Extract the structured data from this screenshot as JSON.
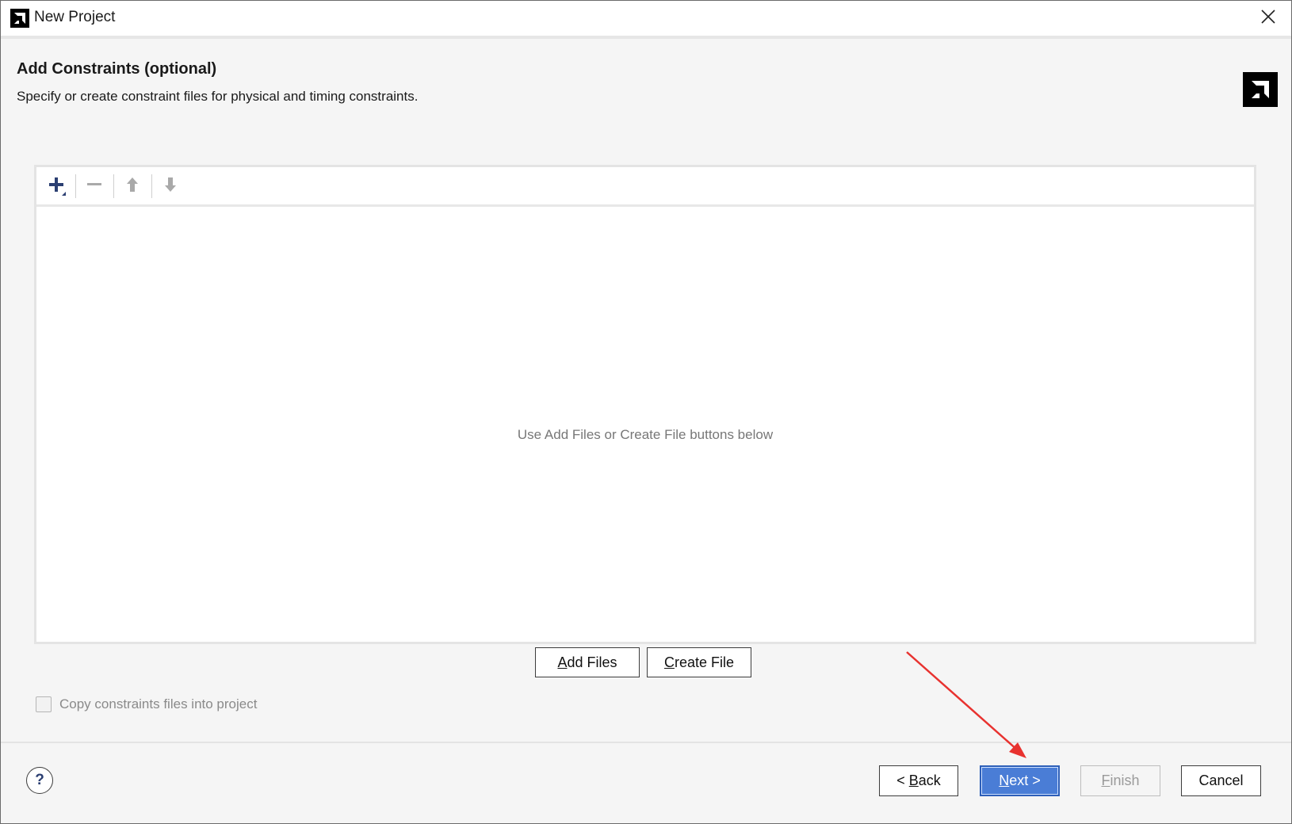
{
  "window": {
    "title": "New Project",
    "logo_icon": "amd-logo-icon",
    "close_icon": "close-icon"
  },
  "header": {
    "title": "Add Constraints (optional)",
    "subtitle": "Specify or create constraint files for physical and timing constraints.",
    "brand_icon": "amd-logo-icon"
  },
  "toolbar": {
    "items": [
      {
        "name": "add",
        "icon": "plus-icon",
        "enabled": true
      },
      {
        "name": "remove",
        "icon": "minus-icon",
        "enabled": false
      },
      {
        "name": "move-up",
        "icon": "arrow-up-icon",
        "enabled": false
      },
      {
        "name": "move-down",
        "icon": "arrow-down-icon",
        "enabled": false
      }
    ]
  },
  "file_list": {
    "empty_message": "Use Add Files or Create File buttons below"
  },
  "file_buttons": {
    "add_files": {
      "mnemonic": "A",
      "rest": "dd Files"
    },
    "create_file": {
      "mnemonic": "C",
      "rest": "reate File"
    }
  },
  "options": {
    "copy_constraints_label": "Copy constraints files into project",
    "copy_constraints_checked": false,
    "copy_constraints_enabled": false
  },
  "footer": {
    "help_label": "?",
    "back": {
      "prefix": "< ",
      "mnemonic": "B",
      "rest": "ack"
    },
    "next": {
      "mnemonic": "N",
      "rest": "ext >"
    },
    "finish": {
      "mnemonic": "F",
      "rest": "inish",
      "enabled": false
    },
    "cancel_label": "Cancel"
  },
  "colors": {
    "accent": "#4a7dd6",
    "annotation_arrow": "#e8322f"
  }
}
